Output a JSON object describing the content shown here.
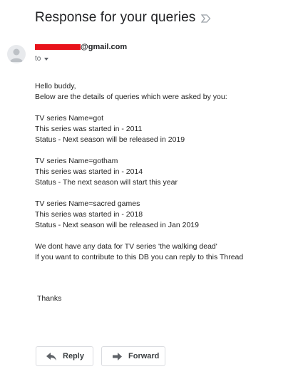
{
  "subject": "Response for your queries",
  "icons": {
    "label": "label-important-outline-icon",
    "avatar": "person-icon",
    "reply": "reply-arrow-icon",
    "forward": "forward-arrow-icon",
    "caret": "chevron-down-icon"
  },
  "sender": {
    "email_suffix": "@gmail.com",
    "redaction_color": "#e8131b"
  },
  "recipient_label": "to",
  "body_lines": [
    "Hello buddy,",
    "Below are the details of queries which were asked by you:",
    "",
    "TV series Name=got",
    "This series was started in - 2011",
    "Status - Next season will be released in 2019",
    "",
    "TV series Name=gotham",
    "This series was started in - 2014",
    "Status - The next season will start this year",
    "",
    "TV series Name=sacred games",
    "This series was started in - 2018",
    "Status - Next season will be released in Jan 2019",
    "",
    "We dont have any data for TV series 'the walking dead'",
    "If you want to contribute to this DB you can reply to this Thread"
  ],
  "signoff": "Thanks",
  "actions": {
    "reply": "Reply",
    "forward": "Forward"
  }
}
